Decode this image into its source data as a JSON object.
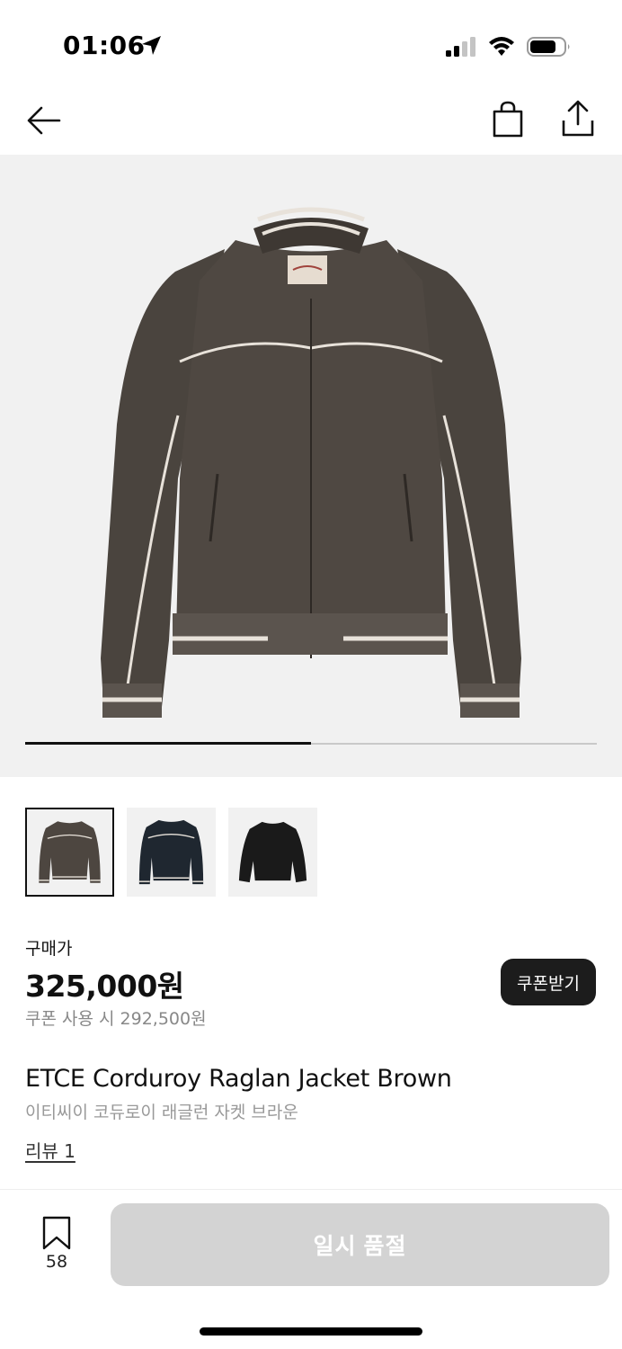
{
  "status_bar": {
    "time": "01:06",
    "icons": [
      "location-arrow-icon",
      "cellular-signal-icon",
      "wifi-icon",
      "battery-icon"
    ]
  },
  "nav": {
    "icons": [
      "back-arrow-icon",
      "shopping-bag-icon",
      "share-icon"
    ]
  },
  "gallery": {
    "image_count": 3,
    "current_index": 1,
    "progress_fraction": 0.5,
    "thumbnails": [
      {
        "color": "brown",
        "selected": true
      },
      {
        "color": "navy",
        "selected": false
      },
      {
        "color": "black",
        "selected": false
      }
    ]
  },
  "price": {
    "label": "구매가",
    "amount": "325,000원",
    "coupon_text": "쿠폰 사용 시 292,500원",
    "coupon_button": "쿠폰받기"
  },
  "product": {
    "name_en": "ETCE Corduroy Raglan Jacket Brown",
    "name_ko": "이티씨이 코듀로이 래글런 자켓 브라운",
    "review_link": "리뷰 1"
  },
  "bottom_bar": {
    "bookmark_count": "58",
    "buy_button": "일시 품절",
    "buy_disabled": true
  },
  "colors": {
    "hero_bg": "#f1f1f1",
    "jacket_brown": "#4d4640",
    "jacket_navy": "#1f2730",
    "jacket_black": "#1a1a1a",
    "accent_dark": "#1c1c1c",
    "disabled_button": "#d3d3d3"
  }
}
